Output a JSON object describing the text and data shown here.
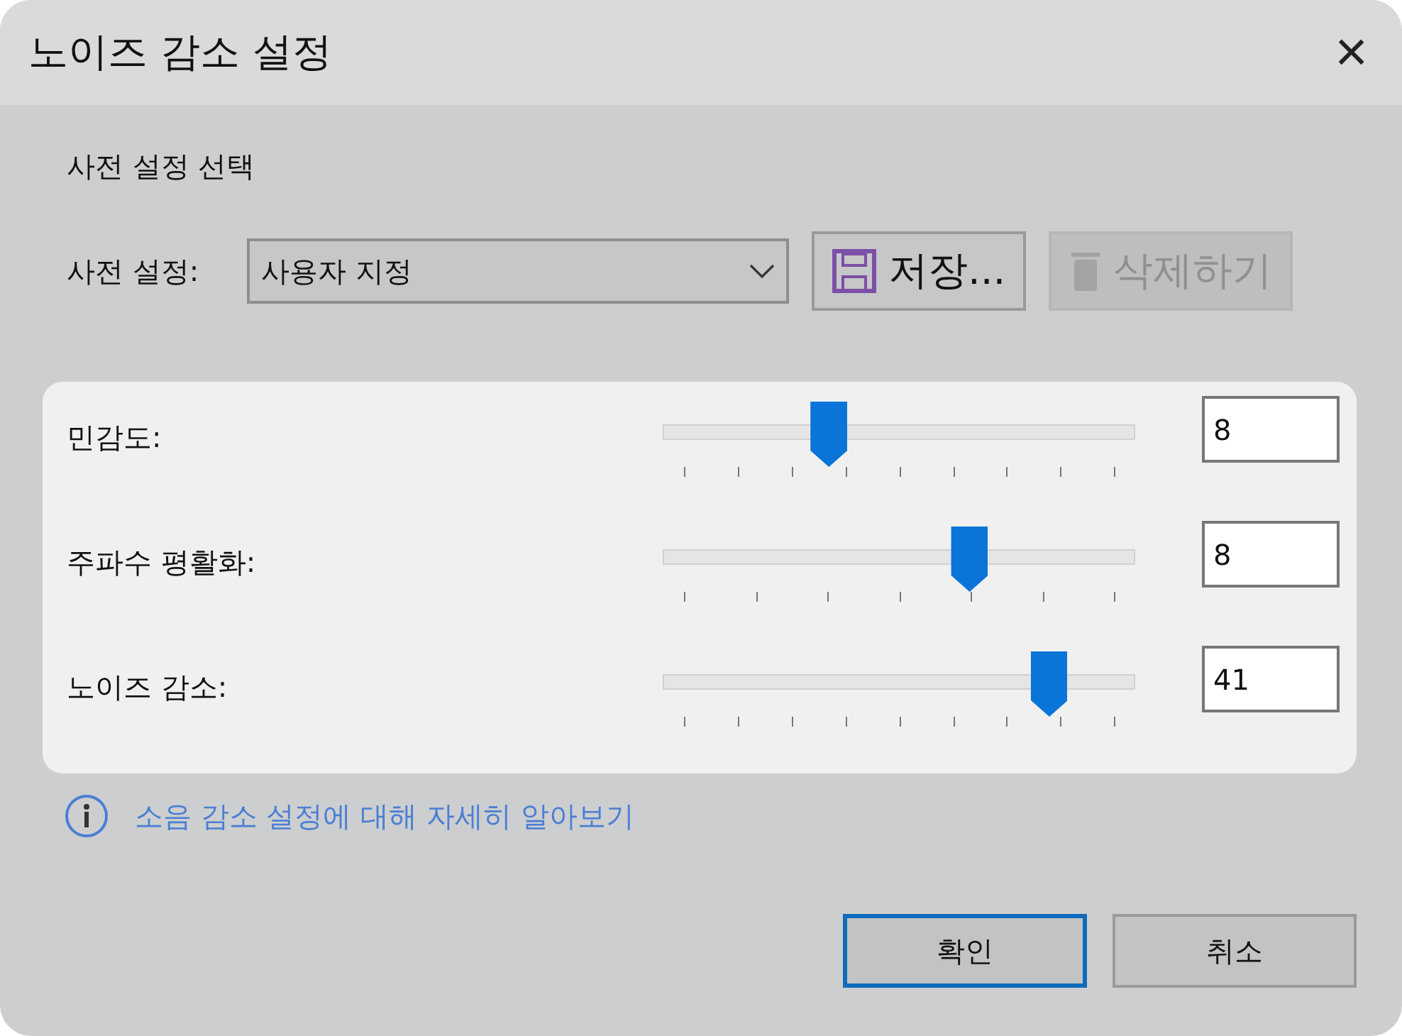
{
  "window": {
    "title": "노이즈 감소 설정",
    "close": "×"
  },
  "preset_section": {
    "heading": "사전 설정 선택",
    "label": "사전 설정:",
    "value": "사용자 지정"
  },
  "preset_buttons": [
    {
      "kind": "save",
      "label": "저장...",
      "disabled": false
    },
    {
      "kind": "delete",
      "label": "삭제하기",
      "disabled": true
    }
  ],
  "sliders": [
    {
      "label": "민감도:",
      "level": 0.35,
      "value": "8"
    },
    {
      "label": "주파수 평활화:",
      "level": 0.65,
      "value": "8"
    },
    {
      "label": "노이즈 감소:",
      "level": 0.82,
      "value": "41"
    }
  ],
  "info_link": "소음 감소 설정에 대해 자세히 알아보기",
  "buttons": [
    {
      "label": "확인",
      "default": true
    },
    {
      "label": "취소",
      "default": false
    }
  ]
}
